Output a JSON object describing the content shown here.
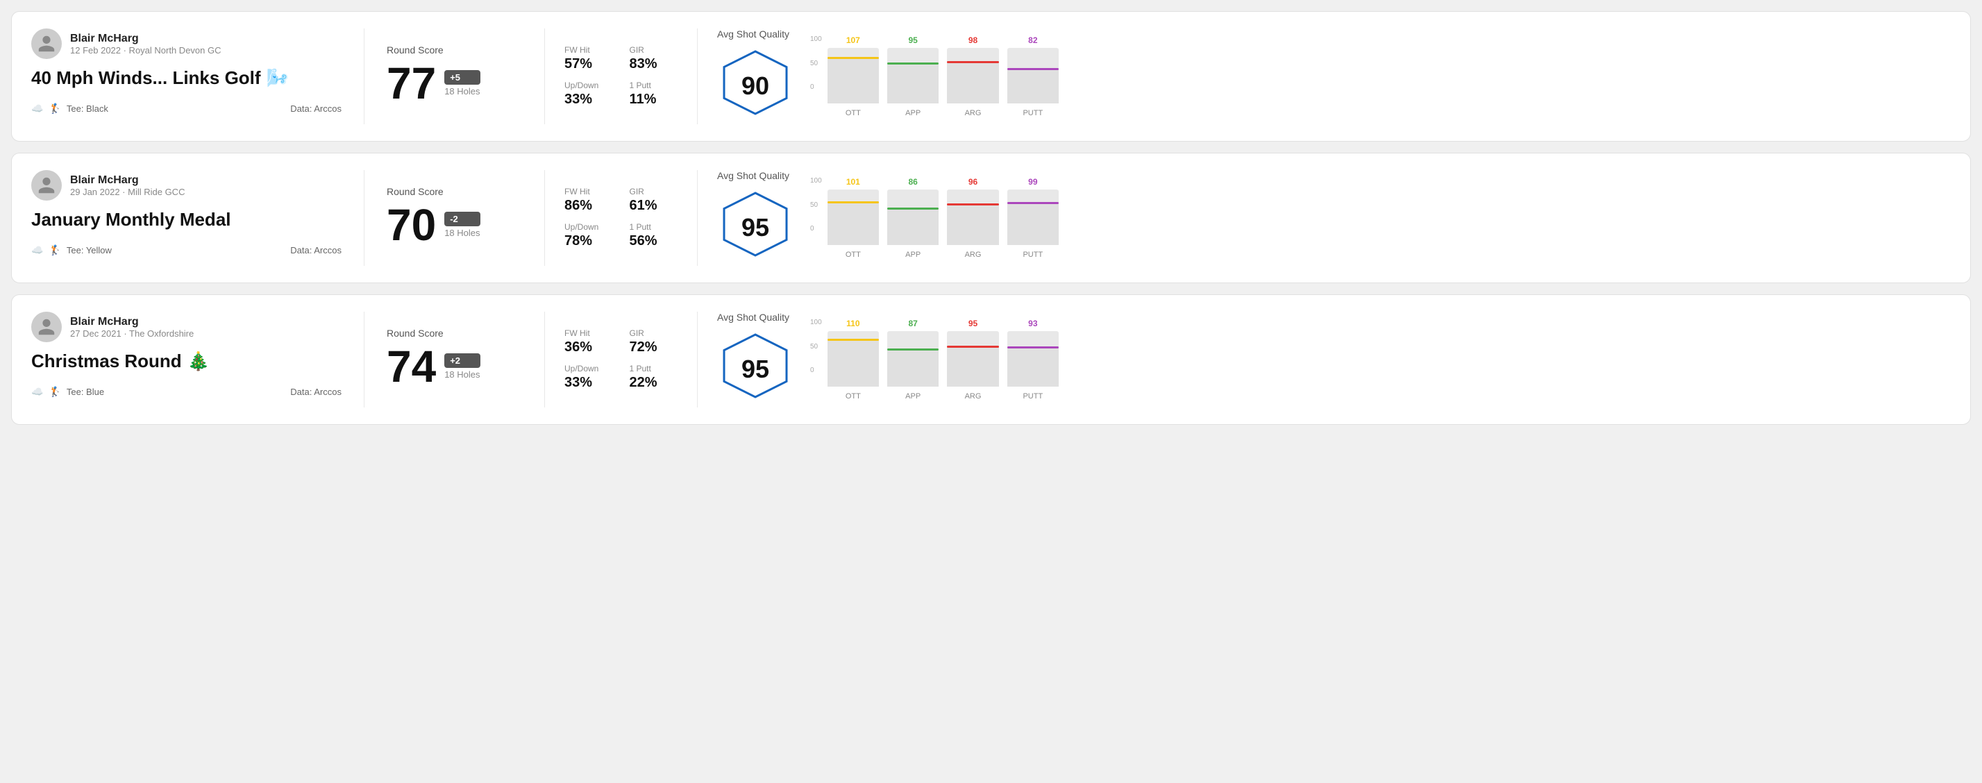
{
  "rounds": [
    {
      "id": "round1",
      "userName": "Blair McHarg",
      "date": "12 Feb 2022 · Royal North Devon GC",
      "title": "40 Mph Winds... Links Golf",
      "titleEmoji": "🌬️",
      "tee": "Tee: Black",
      "dataSource": "Data: Arccos",
      "score": "77",
      "scoreBadge": "+5",
      "badgeType": "positive",
      "holes": "18 Holes",
      "fwHit": "57%",
      "gir": "83%",
      "upDown": "33%",
      "onePutt": "11%",
      "avgShotQuality": "90",
      "bars": [
        {
          "label": "OTT",
          "value": 107,
          "color": "#f5c518",
          "lineColor": "#f5c518"
        },
        {
          "label": "APP",
          "value": 95,
          "color": "#4caf50",
          "lineColor": "#4caf50"
        },
        {
          "label": "ARG",
          "value": 98,
          "color": "#e53935",
          "lineColor": "#e53935"
        },
        {
          "label": "PUTT",
          "value": 82,
          "color": "#ab47bc",
          "lineColor": "#ab47bc"
        }
      ]
    },
    {
      "id": "round2",
      "userName": "Blair McHarg",
      "date": "29 Jan 2022 · Mill Ride GCC",
      "title": "January Monthly Medal",
      "titleEmoji": "",
      "tee": "Tee: Yellow",
      "dataSource": "Data: Arccos",
      "score": "70",
      "scoreBadge": "-2",
      "badgeType": "negative",
      "holes": "18 Holes",
      "fwHit": "86%",
      "gir": "61%",
      "upDown": "78%",
      "onePutt": "56%",
      "avgShotQuality": "95",
      "bars": [
        {
          "label": "OTT",
          "value": 101,
          "color": "#f5c518",
          "lineColor": "#f5c518"
        },
        {
          "label": "APP",
          "value": 86,
          "color": "#4caf50",
          "lineColor": "#4caf50"
        },
        {
          "label": "ARG",
          "value": 96,
          "color": "#e53935",
          "lineColor": "#e53935"
        },
        {
          "label": "PUTT",
          "value": 99,
          "color": "#ab47bc",
          "lineColor": "#ab47bc"
        }
      ]
    },
    {
      "id": "round3",
      "userName": "Blair McHarg",
      "date": "27 Dec 2021 · The Oxfordshire",
      "title": "Christmas Round",
      "titleEmoji": "🎄",
      "tee": "Tee: Blue",
      "dataSource": "Data: Arccos",
      "score": "74",
      "scoreBadge": "+2",
      "badgeType": "positive",
      "holes": "18 Holes",
      "fwHit": "36%",
      "gir": "72%",
      "upDown": "33%",
      "onePutt": "22%",
      "avgShotQuality": "95",
      "bars": [
        {
          "label": "OTT",
          "value": 110,
          "color": "#f5c518",
          "lineColor": "#f5c518"
        },
        {
          "label": "APP",
          "value": 87,
          "color": "#4caf50",
          "lineColor": "#4caf50"
        },
        {
          "label": "ARG",
          "value": 95,
          "color": "#e53935",
          "lineColor": "#e53935"
        },
        {
          "label": "PUTT",
          "value": 93,
          "color": "#ab47bc",
          "lineColor": "#ab47bc"
        }
      ]
    }
  ],
  "labels": {
    "roundScore": "Round Score",
    "fwHit": "FW Hit",
    "gir": "GIR",
    "upDown": "Up/Down",
    "onePutt": "1 Putt",
    "avgShotQuality": "Avg Shot Quality",
    "dataArccos": "Data: Arccos"
  }
}
